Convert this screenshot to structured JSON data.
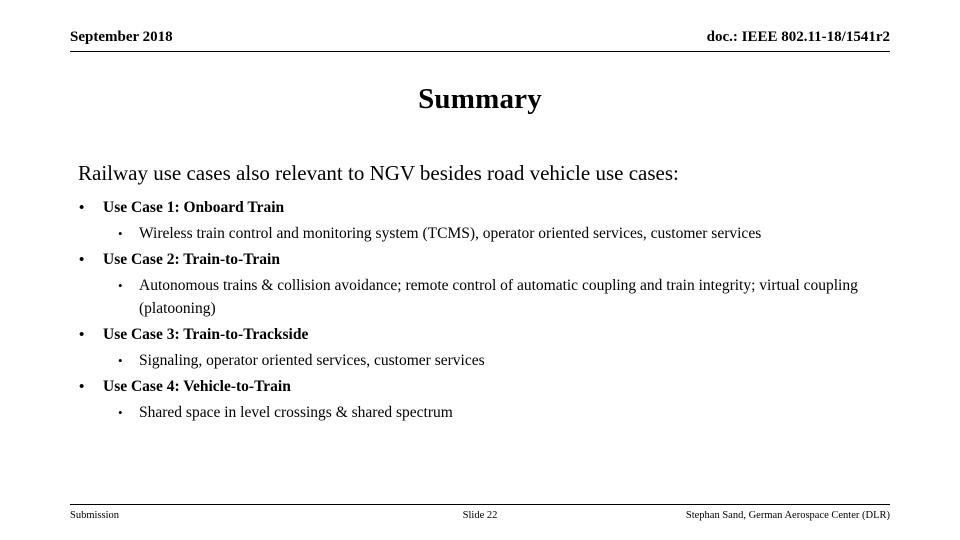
{
  "header": {
    "date": "September 2018",
    "doc": "doc.: IEEE 802.11-18/1541r2"
  },
  "title": "Summary",
  "body": {
    "intro": "Railway use cases also relevant to NGV besides road vehicle use cases:",
    "bullet_marker_level1": "•",
    "bullet_marker_level2": "•",
    "groups": [
      {
        "heading": "Use Case 1: Onboard Train",
        "detail": "Wireless train control and monitoring system (TCMS), operator oriented services, customer services"
      },
      {
        "heading": "Use Case 2: Train-to-Train",
        "detail": "Autonomous trains & collision avoidance; remote control of automatic coupling and train integrity; virtual coupling (platooning)"
      },
      {
        "heading": "Use Case 3: Train-to-Trackside",
        "detail": "Signaling, operator oriented services, customer services"
      },
      {
        "heading": "Use Case 4: Vehicle-to-Train",
        "detail": "Shared space in level crossings & shared spectrum"
      }
    ]
  },
  "footer": {
    "left": "Submission",
    "center": "Slide 22",
    "right": "Stephan Sand, German Aerospace Center (DLR)"
  }
}
